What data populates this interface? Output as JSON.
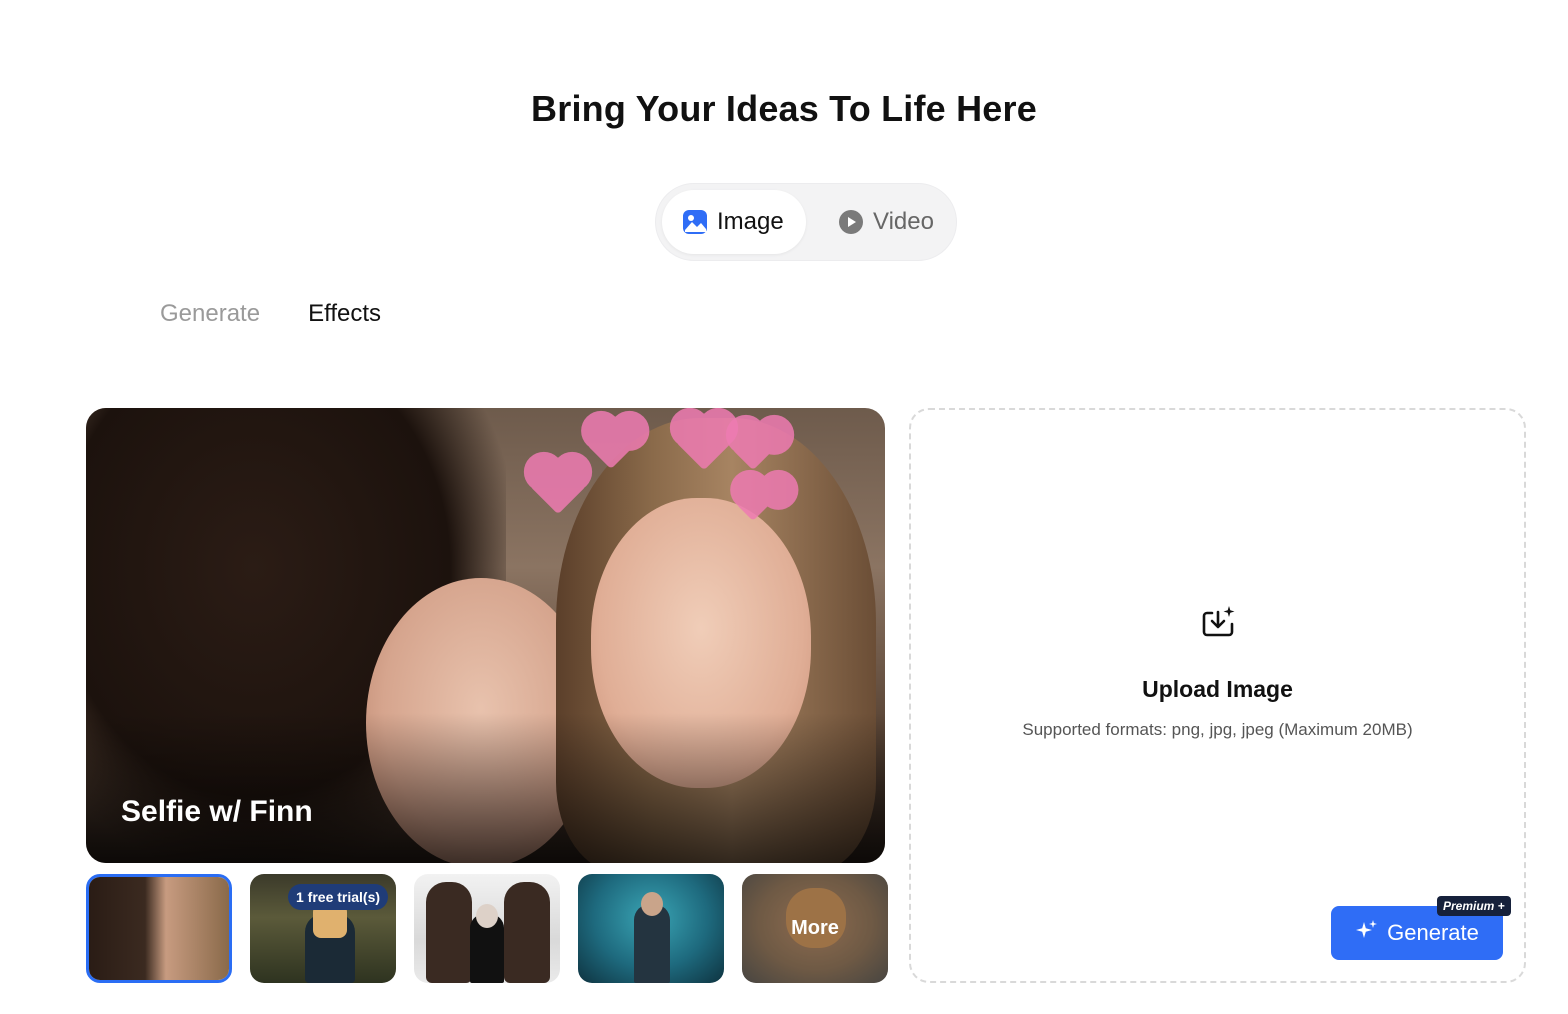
{
  "header": {
    "title": "Bring Your Ideas To Life Here"
  },
  "mode_switch": {
    "options": [
      {
        "label": "Image",
        "icon": "image-icon",
        "active": true
      },
      {
        "label": "Video",
        "icon": "play-circle-icon",
        "active": false
      }
    ]
  },
  "sub_tabs": [
    {
      "label": "Generate",
      "active": false
    },
    {
      "label": "Effects",
      "active": true
    }
  ],
  "preview": {
    "label": "Selfie w/ Finn"
  },
  "thumbnails": [
    {
      "name": "selfie-with-finn",
      "selected": true
    },
    {
      "name": "pixel-art-effect",
      "badge": "1 free trial(s)"
    },
    {
      "name": "creatures-effect"
    },
    {
      "name": "stranger-effect"
    },
    {
      "name": "more",
      "label": "More"
    }
  ],
  "upload": {
    "icon": "upload-image-icon",
    "title": "Upload Image",
    "hint": "Supported formats: png, jpg, jpeg (Maximum 20MB)"
  },
  "generate_button": {
    "label": "Generate",
    "icon": "sparkle-icon",
    "badge": "Premium +"
  },
  "colors": {
    "accent": "#2f6df6",
    "selected_border": "#2a6df4",
    "badge_dark": "#16213b"
  }
}
